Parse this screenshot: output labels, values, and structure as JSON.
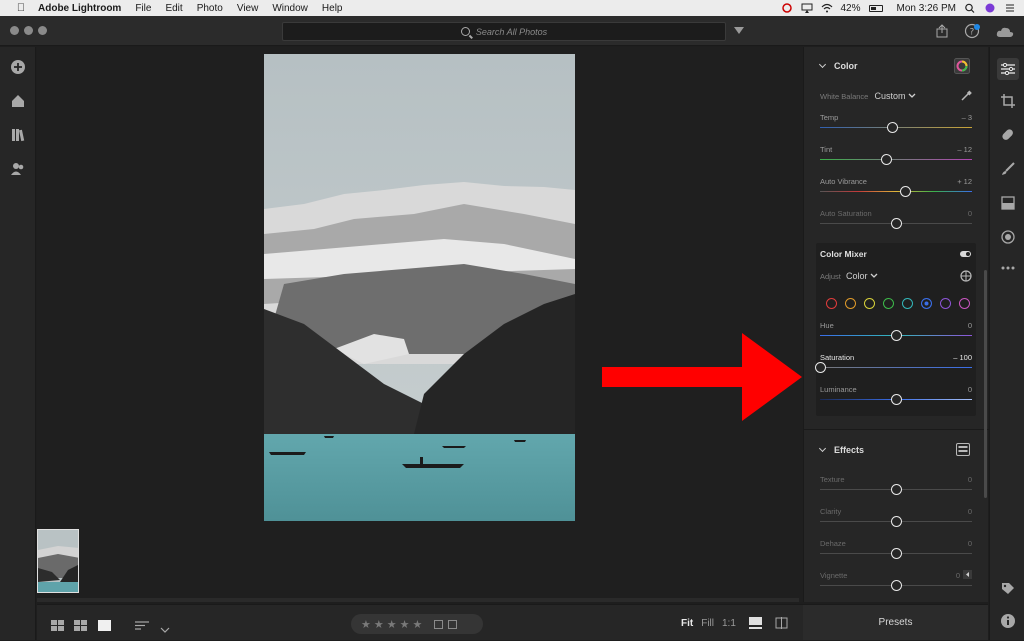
{
  "menubar": {
    "app_name": "Adobe Lightroom",
    "menus": [
      "File",
      "Edit",
      "Photo",
      "View",
      "Window",
      "Help"
    ],
    "battery": "42%",
    "clock": "Mon 3:26 PM"
  },
  "search": {
    "placeholder": "Search All Photos"
  },
  "panel": {
    "color": {
      "title": "Color",
      "white_balance_label": "White Balance",
      "white_balance_value": "Custom",
      "sliders": [
        {
          "label": "Temp",
          "value": "– 3",
          "position": 0.48
        },
        {
          "label": "Tint",
          "value": "– 12",
          "position": 0.44
        },
        {
          "label": "Auto Vibrance",
          "value": "+ 12",
          "position": 0.56
        },
        {
          "label": "Auto Saturation",
          "value": "0",
          "position": 0.5
        }
      ]
    },
    "mixer": {
      "title": "Color Mixer",
      "adjust_label": "Adjust",
      "adjust_value": "Color",
      "swatches": [
        "#e03c3c",
        "#e09a2a",
        "#d8d23a",
        "#3dbb4a",
        "#33b7b9",
        "#3a6ee8",
        "#8d55d8",
        "#c955c0"
      ],
      "selected_swatch": 5,
      "sliders": [
        {
          "label": "Hue",
          "value": "0",
          "position": 0.5
        },
        {
          "label": "Saturation",
          "value": "– 100",
          "position": 0.0
        },
        {
          "label": "Luminance",
          "value": "0",
          "position": 0.5
        }
      ]
    },
    "effects": {
      "title": "Effects",
      "sliders": [
        {
          "label": "Texture",
          "value": "0",
          "position": 0.5
        },
        {
          "label": "Clarity",
          "value": "0",
          "position": 0.5
        },
        {
          "label": "Dehaze",
          "value": "0",
          "position": 0.5
        },
        {
          "label": "Vignette",
          "value": "0",
          "position": 0.5
        }
      ]
    },
    "presets_label": "Presets"
  },
  "bottombar": {
    "stars": "★★★★★",
    "zoom_fit": "Fit",
    "zoom_fill": "Fill",
    "zoom_1to1": "1:1"
  },
  "colors": {
    "accent_red": "#ff0000",
    "panel_bg": "#262626"
  }
}
